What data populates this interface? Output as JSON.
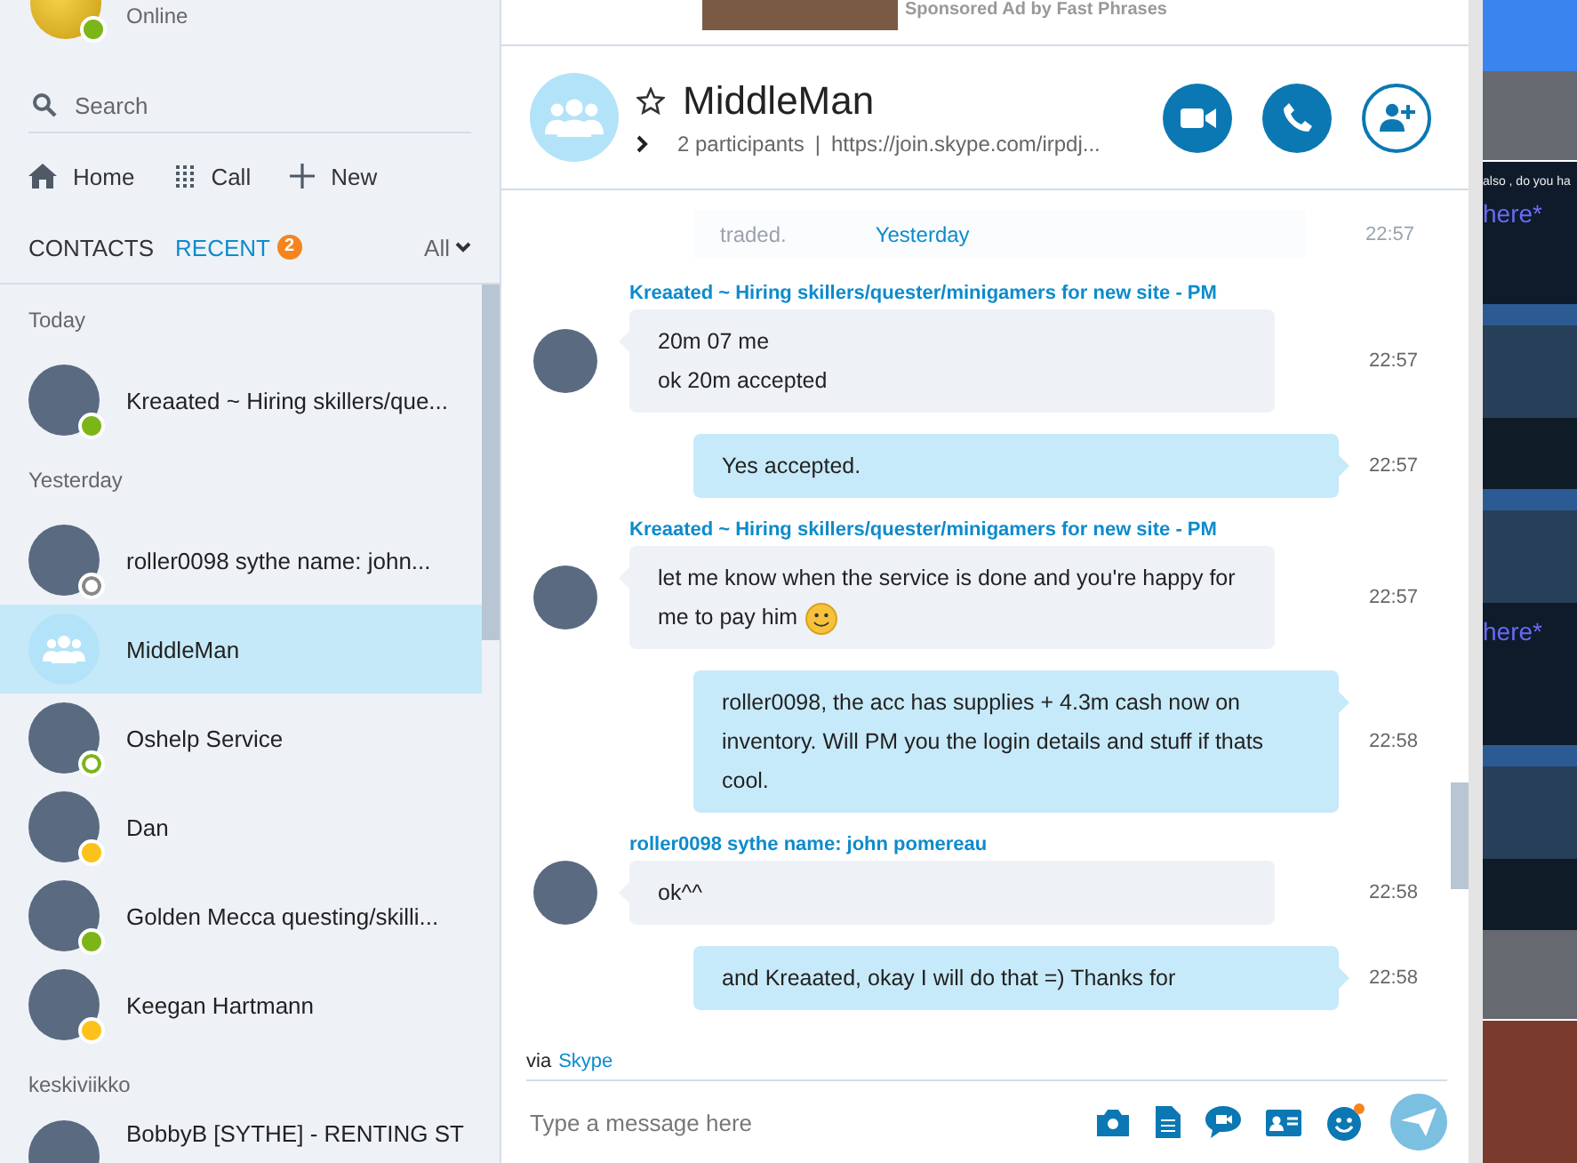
{
  "profile": {
    "status_text": "Online",
    "status": {
      "color": "#7cb518",
      "hollow": false
    }
  },
  "sidebar": {
    "search": {
      "placeholder": "Search"
    },
    "nav": [
      {
        "label": "Home",
        "kind": "home"
      },
      {
        "label": "Call",
        "kind": "dialpad"
      },
      {
        "label": "New",
        "kind": "plus"
      }
    ],
    "tabs": [
      {
        "label": "CONTACTS",
        "selected": false
      },
      {
        "label": "RECENT",
        "selected": true,
        "badge": "2"
      }
    ],
    "filter": "All",
    "sections": [
      {
        "title": "Today",
        "items": [
          {
            "name": "Kreaated ~ Hiring skillers/que...",
            "kind": "contact",
            "status": {
              "color": "#7cb518",
              "hollow": false
            },
            "selected": false
          }
        ]
      },
      {
        "title": "Yesterday",
        "items": [
          {
            "name": "roller0098 sythe name: john...",
            "kind": "contact",
            "status": {
              "color": "#888888",
              "hollow": true
            },
            "selected": false
          },
          {
            "name": "MiddleMan",
            "kind": "group",
            "selected": true
          },
          {
            "name": "Oshelp Service",
            "kind": "contact",
            "status": {
              "color": "#7cb518",
              "hollow": true
            },
            "selected": false
          },
          {
            "name": "Dan",
            "kind": "contact",
            "status": {
              "color": "#fcc21b",
              "hollow": false
            },
            "selected": false
          },
          {
            "name": "Golden Mecca  questing/skilli...",
            "kind": "contact",
            "status": {
              "color": "#7cb518",
              "hollow": false
            },
            "selected": false
          },
          {
            "name": "Keegan Hartmann",
            "kind": "contact",
            "status": {
              "color": "#fcc21b",
              "hollow": false
            },
            "selected": false
          }
        ]
      },
      {
        "title": "keskiviikko",
        "items": [
          {
            "name": "BobbyB [SYTHE] - RENTING ST",
            "kind": "contact",
            "selected": false
          }
        ]
      }
    ]
  },
  "ad": {
    "text": "Sponsored Ad by Fast Phrases"
  },
  "conversation": {
    "title": "MiddleMan",
    "participants": "2 participants",
    "separator": "|",
    "link": "https://join.skype.com/irpdj...",
    "date_divider": {
      "label": "Yesterday",
      "behind_text": "traded.",
      "behind_time": "22:57"
    },
    "messages": [
      {
        "kind": "incoming",
        "sender": "Kreaated ~ Hiring skillers/quester/minigamers for new site - PM",
        "lines": [
          "20m 07 me",
          "ok 20m accepted"
        ],
        "emoji": false,
        "time": "22:57"
      },
      {
        "kind": "outgoing",
        "lines": [
          "Yes accepted."
        ],
        "emoji": false,
        "time": "22:57"
      },
      {
        "kind": "incoming",
        "sender": "Kreaated ~ Hiring skillers/quester/minigamers for new site - PM",
        "lines": [
          "let me know when the service is done and you're happy for me to pay him"
        ],
        "emoji": true,
        "time": "22:57"
      },
      {
        "kind": "outgoing",
        "lines": [
          "roller0098, the acc has supplies + 4.3m cash now on inventory. Will PM you the login details and stuff if thats cool."
        ],
        "emoji": false,
        "time": "22:58"
      },
      {
        "kind": "incoming",
        "sender": "roller0098 sythe name: john pomereau",
        "lines": [
          "ok^^"
        ],
        "emoji": false,
        "time": "22:58"
      },
      {
        "kind": "outgoing",
        "lines": [
          "and Kreaated, okay I will do that =) Thanks for"
        ],
        "emoji": false,
        "time": "22:58"
      }
    ],
    "via": "via",
    "via_link": "Skype",
    "composer": {
      "placeholder": "Type a message here"
    }
  },
  "background_window": {
    "texts": [
      "also , do you ha",
      "here*",
      "here*"
    ]
  }
}
